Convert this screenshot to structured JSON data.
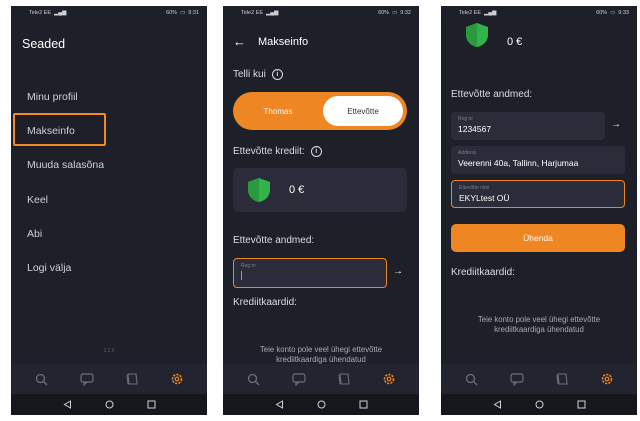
{
  "status_bar": {
    "carrier": "Tele2 EE",
    "battery": "60%",
    "time_1": "9:31",
    "time_2": "9:32",
    "time_3": "9:33"
  },
  "screen1": {
    "title": "Seaded",
    "menu": [
      {
        "label": "Minu profiil"
      },
      {
        "label": "Makseinfo"
      },
      {
        "label": "Muuda salasõna"
      },
      {
        "label": "Keel"
      },
      {
        "label": "Abi"
      },
      {
        "label": "Logi välja"
      }
    ],
    "version": "3.2.6"
  },
  "screen2": {
    "title": "Makseinfo",
    "pay_as_label": "Telli kui",
    "toggle_left": "Thomas",
    "toggle_right": "Ettevõtte",
    "company_credit_label": "Ettevõtte krediit:",
    "credit_value": "0 €",
    "company_data_label": "Ettevõtte andmed:",
    "reg_field_label": "Reg nr",
    "credit_cards_label": "Krediitkaardid:",
    "no_cards_msg_1": "Teie konto pole veel ühegi ettevõtte",
    "no_cards_msg_2": "krediitkaardiga ühendatud"
  },
  "screen3": {
    "credit_value": "0 €",
    "company_data_label": "Ettevõtte andmed:",
    "reg_field_label": "Reg nr",
    "reg_field_value": "1234567",
    "address_label": "Address",
    "address_value": "Veerenni 40a, Tallinn, Harjumaa",
    "company_name_label": "Ettevõtte nimi",
    "company_name_value": "EKYLtest OÜ",
    "connect_button": "Ühenda",
    "credit_cards_label": "Krediitkaardid:",
    "no_cards_msg_1": "Teie konto pole veel ühegi ettevõtte",
    "no_cards_msg_2": "krediitkaardiga ühendatud"
  },
  "colors": {
    "background": "#1d1f29",
    "accent": "#ee8623",
    "card": "#2a2d39",
    "credit_icon": "#34b34a"
  },
  "icons": {
    "nav": [
      "search-icon",
      "chat-icon",
      "document-icon",
      "settings-icon"
    ],
    "system": [
      "back-icon",
      "home-icon",
      "recents-icon"
    ]
  }
}
